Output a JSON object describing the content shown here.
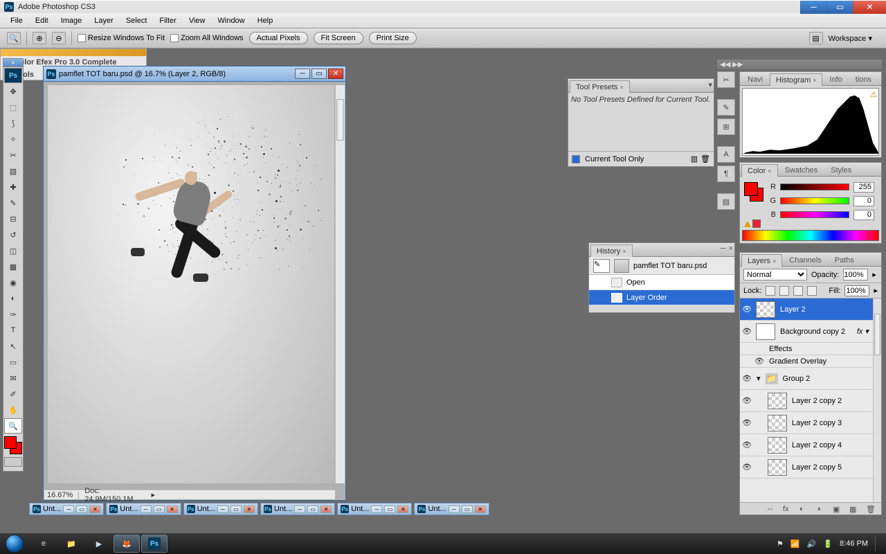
{
  "title": "Adobe Photoshop CS3",
  "menu": [
    "File",
    "Edit",
    "Image",
    "Layer",
    "Select",
    "Filter",
    "View",
    "Window",
    "Help"
  ],
  "options_bar": {
    "resize_to_fit": "Resize Windows To Fit",
    "zoom_all": "Zoom All Windows",
    "actual_pixels": "Actual Pixels",
    "fit_screen": "Fit Screen",
    "print_size": "Print Size",
    "workspace": "Workspace ▾"
  },
  "document": {
    "title": "pamflet TOT baru.psd @ 16.7% (Layer 2, RGB/8)",
    "zoom": "16.67%",
    "docinfo": "Doc: 24.9M/150.1M"
  },
  "doc_tabs": [
    "Unt...",
    "Unt...",
    "Unt...",
    "Unt...",
    "Unt...",
    "Unt..."
  ],
  "tool_presets": {
    "tab": "Tool Presets",
    "empty": "No Tool Presets Defined for Current Tool.",
    "current_only": "Current Tool Only"
  },
  "nav_panel": {
    "tabs": [
      "Navi",
      "Histogram",
      "Info",
      "tions"
    ]
  },
  "color_panel": {
    "tabs": [
      "Color",
      "Swatches",
      "Styles"
    ],
    "R": "255",
    "G": "0",
    "B": "0"
  },
  "history": {
    "tab": "History",
    "file": "pamflet TOT baru.psd",
    "items": [
      "Open",
      "Layer Order"
    ]
  },
  "efex": {
    "line1": "Color Efex Pro 3.0 Complete",
    "line2": "Tools"
  },
  "layers_panel": {
    "tabs": [
      "Layers",
      "Channels",
      "Paths"
    ],
    "blend": "Normal",
    "opacity_label": "Opacity:",
    "opacity": "100%",
    "lock_label": "Lock:",
    "fill_label": "Fill:",
    "fill": "100%",
    "layers": [
      {
        "name": "Layer 2",
        "sel": true,
        "thumb": "checker"
      },
      {
        "name": "Background copy 2",
        "thumb": "solid",
        "fx": true
      },
      {
        "name": "Effects",
        "sub": true
      },
      {
        "name": "Gradient Overlay",
        "sub": true,
        "eye": true
      },
      {
        "name": "Group 2",
        "folder": true
      },
      {
        "name": "Layer 2 copy 2",
        "indent": true,
        "thumb": "checker"
      },
      {
        "name": "Layer 2 copy 3",
        "indent": true,
        "thumb": "checker"
      },
      {
        "name": "Layer 2 copy 4",
        "indent": true,
        "thumb": "checker"
      },
      {
        "name": "Layer 2 copy 5",
        "indent": true,
        "thumb": "checker"
      }
    ]
  },
  "taskbar": {
    "time": "8:46 PM"
  }
}
